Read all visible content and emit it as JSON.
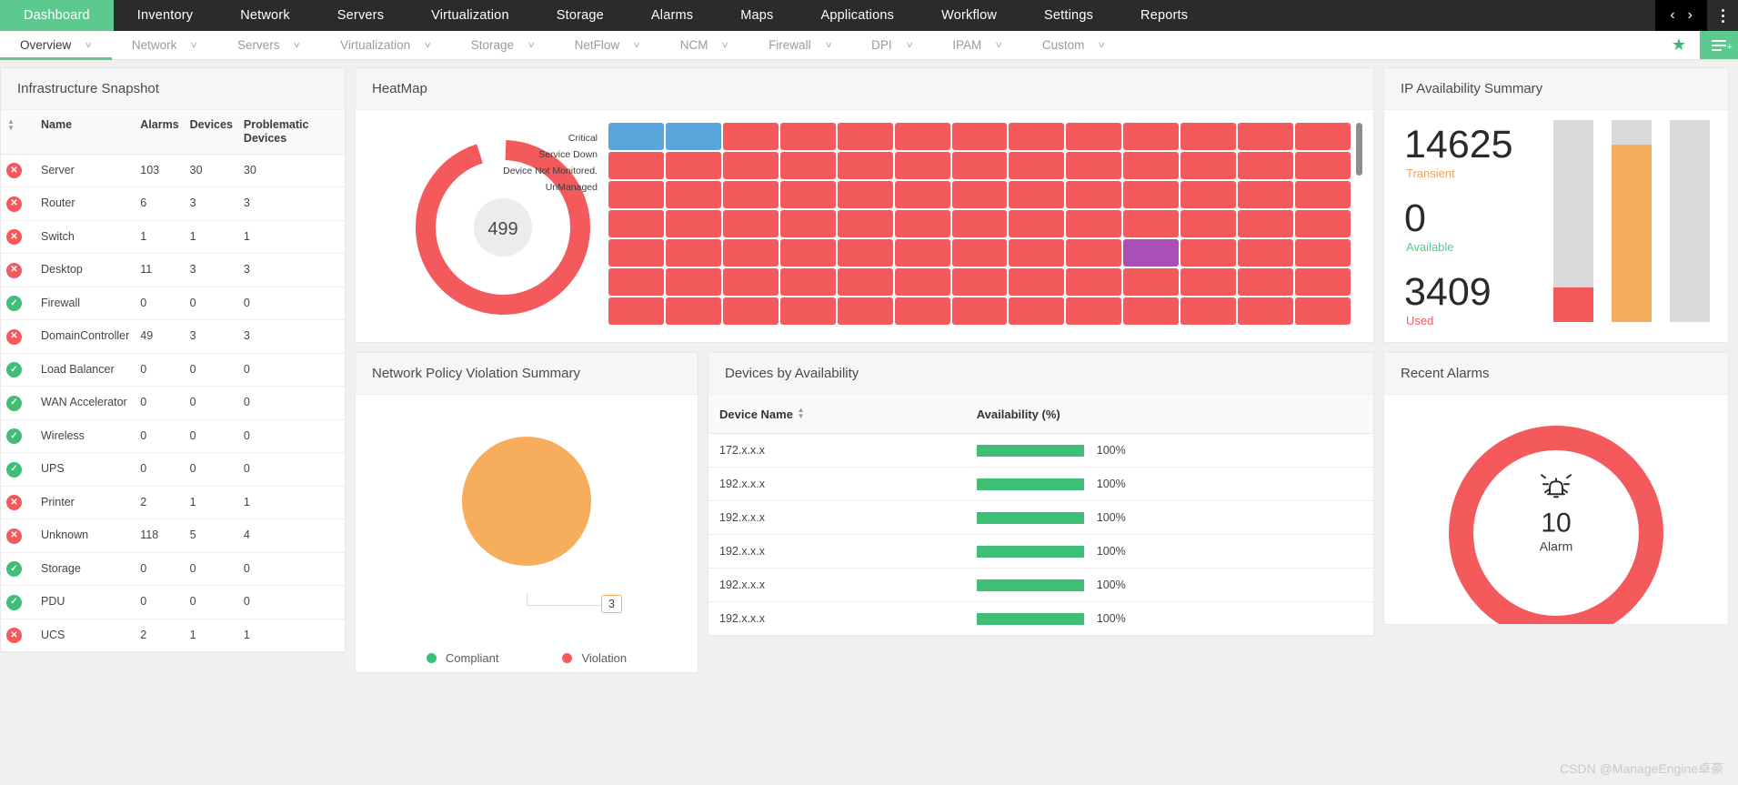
{
  "topnav": {
    "items": [
      {
        "label": "Dashboard",
        "active": true
      },
      {
        "label": "Inventory",
        "active": false
      },
      {
        "label": "Network",
        "active": false
      },
      {
        "label": "Servers",
        "active": false
      },
      {
        "label": "Virtualization",
        "active": false
      },
      {
        "label": "Storage",
        "active": false
      },
      {
        "label": "Alarms",
        "active": false
      },
      {
        "label": "Maps",
        "active": false
      },
      {
        "label": "Applications",
        "active": false
      },
      {
        "label": "Workflow",
        "active": false
      },
      {
        "label": "Settings",
        "active": false
      },
      {
        "label": "Reports",
        "active": false
      }
    ],
    "prev_icon": "‹",
    "next_icon": "›"
  },
  "subnav": {
    "items": [
      {
        "label": "Overview",
        "active": true
      },
      {
        "label": "Network",
        "active": false
      },
      {
        "label": "Servers",
        "active": false
      },
      {
        "label": "Virtualization",
        "active": false
      },
      {
        "label": "Storage",
        "active": false
      },
      {
        "label": "NetFlow",
        "active": false
      },
      {
        "label": "NCM",
        "active": false
      },
      {
        "label": "Firewall",
        "active": false
      },
      {
        "label": "DPI",
        "active": false
      },
      {
        "label": "IPAM",
        "active": false
      },
      {
        "label": "Custom",
        "active": false
      }
    ],
    "caret": "∨",
    "star": "★",
    "plus": "+"
  },
  "infrastructure": {
    "title": "Infrastructure Snapshot",
    "columns": [
      "",
      "Name",
      "Alarms",
      "Devices",
      "Problematic Devices"
    ],
    "rows": [
      {
        "status": "err",
        "name": "Server",
        "alarms": "103",
        "devices": "30",
        "problematic": "30"
      },
      {
        "status": "err",
        "name": "Router",
        "alarms": "6",
        "devices": "3",
        "problematic": "3"
      },
      {
        "status": "err",
        "name": "Switch",
        "alarms": "1",
        "devices": "1",
        "problematic": "1"
      },
      {
        "status": "err",
        "name": "Desktop",
        "alarms": "11",
        "devices": "3",
        "problematic": "3"
      },
      {
        "status": "ok",
        "name": "Firewall",
        "alarms": "0",
        "devices": "0",
        "problematic": "0"
      },
      {
        "status": "err",
        "name": "DomainController",
        "alarms": "49",
        "devices": "3",
        "problematic": "3"
      },
      {
        "status": "ok",
        "name": "Load Balancer",
        "alarms": "0",
        "devices": "0",
        "problematic": "0"
      },
      {
        "status": "ok",
        "name": "WAN Accelerator",
        "alarms": "0",
        "devices": "0",
        "problematic": "0"
      },
      {
        "status": "ok",
        "name": "Wireless",
        "alarms": "0",
        "devices": "0",
        "problematic": "0"
      },
      {
        "status": "ok",
        "name": "UPS",
        "alarms": "0",
        "devices": "0",
        "problematic": "0"
      },
      {
        "status": "err",
        "name": "Printer",
        "alarms": "2",
        "devices": "1",
        "problematic": "1"
      },
      {
        "status": "err",
        "name": "Unknown",
        "alarms": "118",
        "devices": "5",
        "problematic": "4"
      },
      {
        "status": "ok",
        "name": "Storage",
        "alarms": "0",
        "devices": "0",
        "problematic": "0"
      },
      {
        "status": "ok",
        "name": "PDU",
        "alarms": "0",
        "devices": "0",
        "problematic": "0"
      },
      {
        "status": "err",
        "name": "UCS",
        "alarms": "2",
        "devices": "1",
        "problematic": "1"
      }
    ]
  },
  "heatmap": {
    "title": "HeatMap",
    "total": "499",
    "legend": [
      {
        "label": "Critical",
        "color": "#f4595b"
      },
      {
        "label": "Service Down",
        "color": "#aa4fb6"
      },
      {
        "label": "Device Not Monitored.",
        "color": "#58a6dc"
      },
      {
        "label": "UnManaged",
        "color": "#8d8d8d"
      }
    ],
    "grid": {
      "columns": 13,
      "rows": 8,
      "default_state": "critical",
      "cells": [
        {
          "row": 0,
          "col": 0,
          "state": "device-not-monitored"
        },
        {
          "row": 0,
          "col": 1,
          "state": "device-not-monitored"
        },
        {
          "row": 4,
          "col": 9,
          "state": "service-down"
        },
        {
          "row": 7,
          "col": 5,
          "state": "unmanaged"
        }
      ]
    }
  },
  "chart_data": [
    {
      "type": "pie",
      "title": "HeatMap",
      "labels": [
        "Critical",
        "Service Down",
        "Device Not Monitored.",
        "UnManaged"
      ],
      "values": [
        470,
        14,
        13,
        2
      ],
      "colors": [
        "#f4595b",
        "#aa4fb6",
        "#58a6dc",
        "#8d8d8d"
      ],
      "center_label": "499",
      "legend": "left"
    },
    {
      "type": "pie",
      "title": "Network Policy Violation Summary",
      "labels": [
        "Compliant",
        "Violation"
      ],
      "values": [
        3,
        0
      ],
      "colors": [
        "#f6ad5c",
        "#f4595b"
      ],
      "annotations": [
        "3"
      ],
      "legend": "bottom"
    },
    {
      "type": "bar",
      "title": "IP Availability Summary",
      "categories": [
        "Transient",
        "Available",
        "Used"
      ],
      "values": [
        14625,
        0,
        3409
      ],
      "colors": [
        "#f4595b",
        "#f6ad5c",
        "#d9d9d9"
      ],
      "ylabel": "",
      "xlabel": ""
    },
    {
      "type": "bar",
      "title": "Devices by Availability",
      "categories": [
        "172.x.x.x",
        "192.x.x.x",
        "192.x.x.x",
        "192.x.x.x",
        "192.x.x.x",
        "192.x.x.x"
      ],
      "values": [
        100,
        100,
        100,
        100,
        100,
        100
      ],
      "ylabel": "Availability (%)",
      "ylim": [
        0,
        100
      ]
    },
    {
      "type": "pie",
      "title": "Recent Alarms",
      "labels": [
        "Alarm"
      ],
      "values": [
        10
      ],
      "colors": [
        "#f4595b"
      ],
      "center_label": "10",
      "center_sub": "Alarm"
    }
  ],
  "policy": {
    "title": "Network Policy Violation Summary",
    "callout": "3",
    "legend": [
      {
        "label": "Compliant",
        "color": "#3fbf76"
      },
      {
        "label": "Violation",
        "color": "#f4595b"
      }
    ]
  },
  "devices_availability": {
    "title": "Devices by Availability",
    "columns": [
      "Device Name",
      "Availability (%)"
    ],
    "rows": [
      {
        "name": "172.x.x.x",
        "pct": "100%",
        "value": 100
      },
      {
        "name": "192.x.x.x",
        "pct": "100%",
        "value": 100
      },
      {
        "name": "192.x.x.x",
        "pct": "100%",
        "value": 100
      },
      {
        "name": "192.x.x.x",
        "pct": "100%",
        "value": 100
      },
      {
        "name": "192.x.x.x",
        "pct": "100%",
        "value": 100
      },
      {
        "name": "192.x.x.x",
        "pct": "100%",
        "value": 100
      }
    ]
  },
  "ip_availability": {
    "title": "IP Availability Summary",
    "transient": {
      "value": "14625",
      "label": "Transient"
    },
    "available": {
      "value": "0",
      "label": "Available"
    },
    "used": {
      "value": "3409",
      "label": "Used"
    },
    "bars": [
      {
        "name": "transient",
        "fill_color": "#f4595b",
        "fill_pct": 17,
        "track_color": "#d9d9d9"
      },
      {
        "name": "available",
        "fill_color": "#f6ad5c",
        "fill_pct": 88,
        "track_color": "#d9d9d9"
      },
      {
        "name": "used",
        "fill_color": "#d9d9d9",
        "fill_pct": 0,
        "track_color": "#d9d9d9"
      }
    ]
  },
  "recent_alarms": {
    "title": "Recent Alarms",
    "count": "10",
    "label": "Alarm",
    "color": "#f4595b"
  },
  "watermark": "CSDN @ManageEngine卓豪"
}
